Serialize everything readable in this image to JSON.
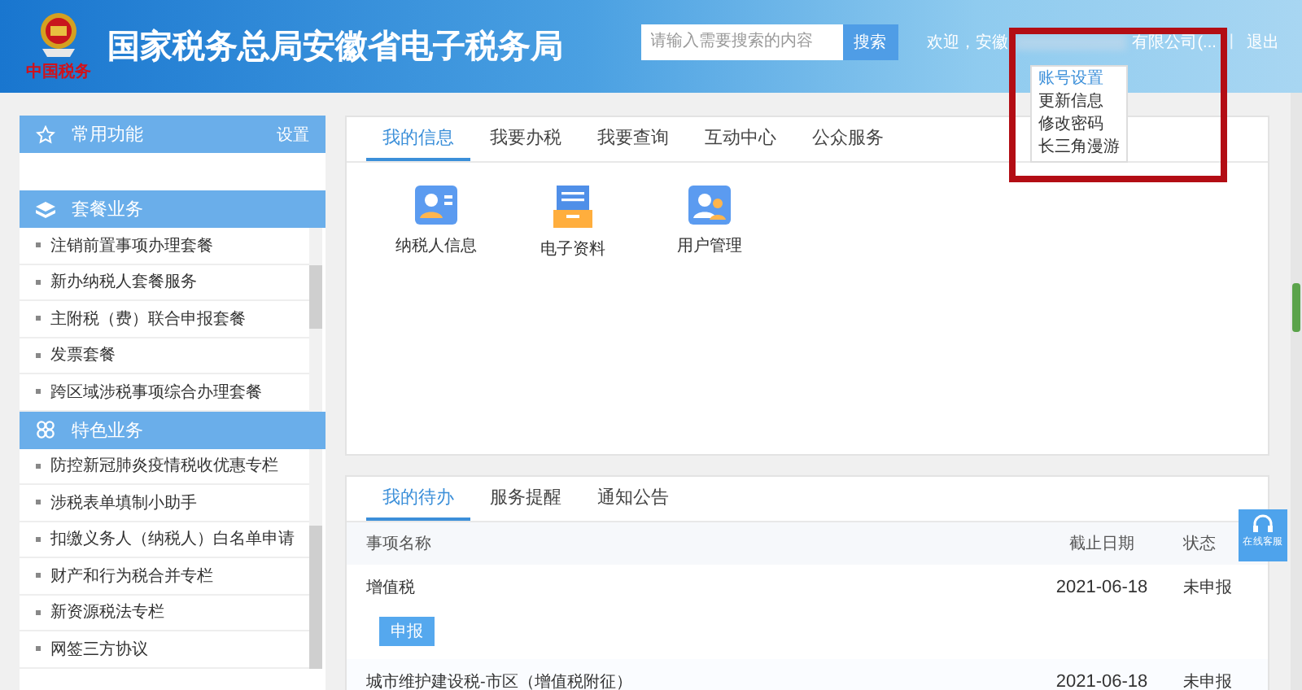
{
  "header": {
    "logo_text": "中国税务",
    "title": "国家税务总局安徽省电子税务局"
  },
  "search": {
    "placeholder": "请输入需要搜索的内容",
    "button": "搜索"
  },
  "user": {
    "greeting": "欢迎，安徽",
    "name_tail": "有限公司(...",
    "separator": "|",
    "logout": "退出"
  },
  "user_menu": [
    {
      "label": "账号设置",
      "selected": true
    },
    {
      "label": "更新信息",
      "selected": false
    },
    {
      "label": "修改密码",
      "selected": false
    },
    {
      "label": "长三角漫游",
      "selected": false
    }
  ],
  "sidebar": [
    {
      "kind": "favorites",
      "title": "常用功能",
      "action": "设置"
    },
    {
      "kind": "packages",
      "title": "套餐业务",
      "items": [
        "注销前置事项办理套餐",
        "新办纳税人套餐服务",
        "主附税（费）联合申报套餐",
        "发票套餐",
        "跨区域涉税事项综合办理套餐"
      ]
    },
    {
      "kind": "special",
      "title": "特色业务",
      "items": [
        "防控新冠肺炎疫情税收优惠专栏",
        "涉税表单填制小助手",
        "扣缴义务人（纳税人）白名单申请",
        "财产和行为税合并专栏",
        "新资源税法专栏",
        "网签三方协议"
      ]
    }
  ],
  "main_tabs": [
    {
      "label": "我的信息",
      "selected": true
    },
    {
      "label": "我要办税",
      "selected": false
    },
    {
      "label": "我要查询",
      "selected": false
    },
    {
      "label": "互动中心",
      "selected": false
    },
    {
      "label": "公众服务",
      "selected": false
    }
  ],
  "quick_links": [
    {
      "kind": "profile",
      "label": "纳税人信息"
    },
    {
      "kind": "documents",
      "label": "电子资料"
    },
    {
      "kind": "users",
      "label": "用户管理"
    }
  ],
  "todo": {
    "tabs": [
      {
        "label": "我的待办",
        "selected": true
      },
      {
        "label": "服务提醒",
        "selected": false
      },
      {
        "label": "通知公告",
        "selected": false
      }
    ],
    "columns": [
      "事项名称",
      "截止日期",
      "状态"
    ],
    "rows": [
      {
        "name": "增值税",
        "deadline": "2021-06-18",
        "status": "未申报",
        "action": "申报"
      },
      {
        "name": "城市维护建设税-市区（增值税附征）",
        "deadline": "2021-06-18",
        "status": "未申报"
      }
    ]
  },
  "service_button": "在线客服"
}
